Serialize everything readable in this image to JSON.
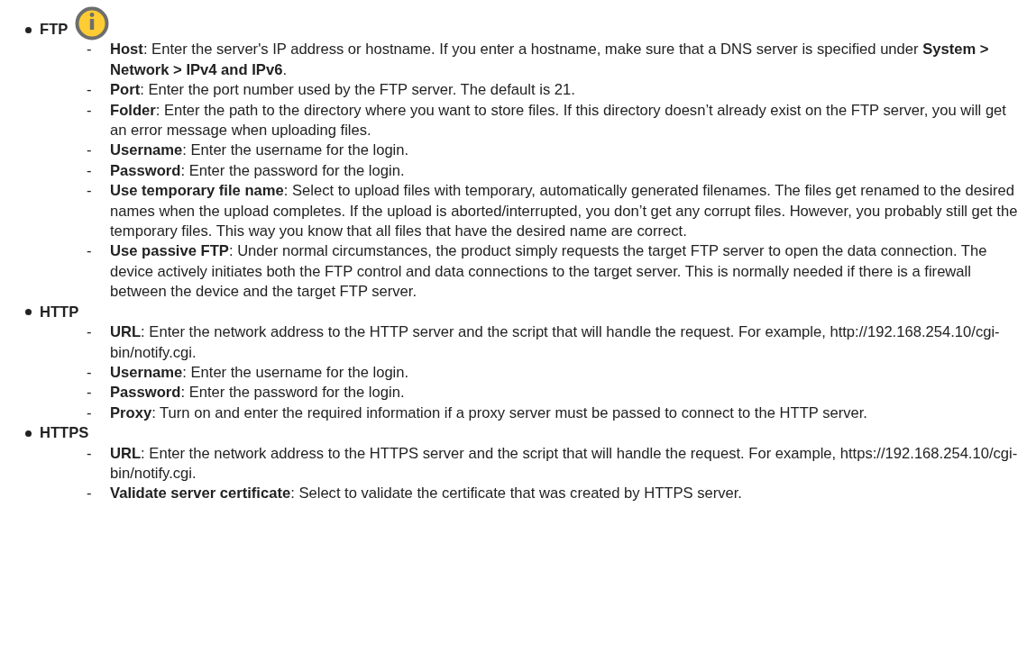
{
  "sections": [
    {
      "title": "FTP",
      "info_icon": true,
      "items": [
        {
          "marker": "-",
          "text": "**Host**: Enter the server's IP address or hostname. If you enter a hostname, make sure that a DNS server is specified under **System > Network > IPv4 and IPv6**."
        },
        {
          "marker": "-",
          "text": "**Port**: Enter the port number used by the FTP server. The default is 21."
        },
        {
          "marker": "-",
          "text": "**Folder**: Enter the path to the directory where you want to store files. If this directory doesn’t already exist on the FTP server, you will get an error message when uploading files."
        },
        {
          "marker": "-",
          "text": "**Username**: Enter the username for the login."
        },
        {
          "marker": "-",
          "text": "**Password**: Enter the password for the login."
        },
        {
          "marker": "-",
          "text": "**Use temporary file name**: Select to upload files with temporary, automatically generated filenames. The files get renamed to the desired names when the upload completes. If the upload is aborted/interrupted, you don’t get any corrupt files. However, you probably still get the temporary files. This way you know that all files that have the desired name are correct."
        },
        {
          "marker": "-",
          "text": "**Use passive FTP**: Under normal circumstances, the product simply requests the target FTP server to open the data connection. The device actively initiates both the FTP control and data connections to the target server. This is normally needed if there is a firewall between the device and the target FTP server."
        }
      ]
    },
    {
      "title": "HTTP",
      "info_icon": false,
      "items": [
        {
          "marker": "-",
          "text": "**URL**: Enter the network address to the HTTP server and the script that will handle the request. For example, http://192.168.254.10/cgi-bin/notify.cgi."
        },
        {
          "marker": "-",
          "text": "**Username**: Enter the username for the login."
        },
        {
          "marker": "-",
          "text": "**Password**: Enter the password for the login."
        },
        {
          "marker": "-",
          "text": "**Proxy**: Turn on and enter the required information if a proxy server must be passed to connect to the HTTP server."
        }
      ]
    },
    {
      "title": "HTTPS",
      "info_icon": false,
      "items": [
        {
          "marker": "-",
          "text": "**URL**: Enter the network address to the HTTPS server and the script that will handle the request. For example, https://192.168.254.10/cgi-bin/notify.cgi."
        },
        {
          "marker": "-",
          "text": "**Validate server certificate**: Select to validate the certificate that was created by HTTPS server."
        }
      ]
    }
  ]
}
